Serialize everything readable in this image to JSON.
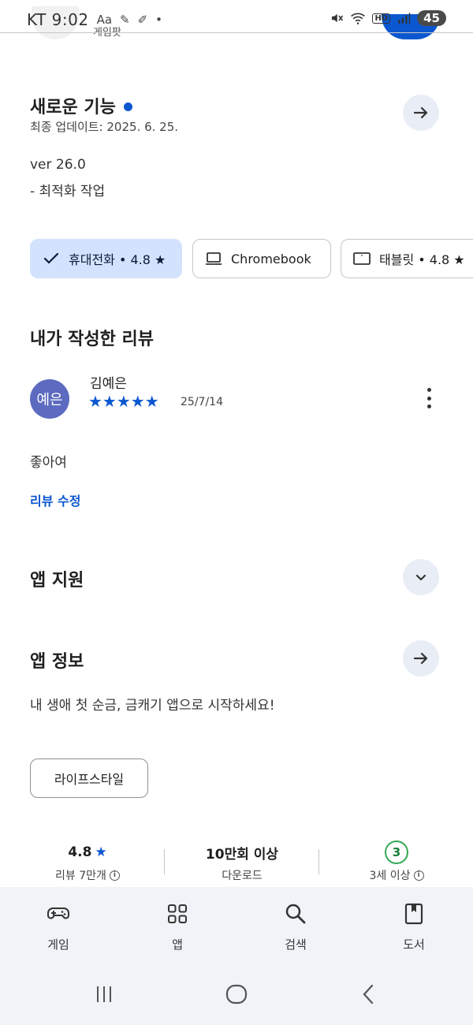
{
  "status_bar": {
    "carrier": "KT",
    "time": "9:02",
    "battery": "45",
    "network_badge": "HD"
  },
  "top_remnant_text": "게임팟",
  "whats_new": {
    "title": "새로운 기능",
    "updated": "최종 업데이트: 2025. 6. 25.",
    "version": "ver 26.0",
    "notes": "- 최적화 작업"
  },
  "device_chips": [
    {
      "label": "휴대전화 • 4.8 ★",
      "icon": "check-icon",
      "selected": true
    },
    {
      "label": "Chromebook",
      "icon": "laptop-icon",
      "selected": false
    },
    {
      "label": "태블릿 • 4.8 ★",
      "icon": "tablet-icon",
      "selected": false
    }
  ],
  "my_review": {
    "title": "내가 작성한 리뷰",
    "avatar_text": "예은",
    "reviewer": "김예은",
    "rating": 5,
    "stars": "★★★★★",
    "date": "25/7/14",
    "text": "좋아여",
    "edit_link": "리뷰 수정"
  },
  "app_support": {
    "title": "앱 지원"
  },
  "app_info": {
    "title": "앱 정보",
    "description": "내 생애 첫 순금, 금캐기 앱으로 시작하세요!",
    "category": "라이프스타일"
  },
  "stats": {
    "rating_value": "4.8",
    "rating_star": "★",
    "rating_label": "리뷰 7만개",
    "downloads_value": "10만회 이상",
    "downloads_label": "다운로드",
    "age_value": "3",
    "age_label": "3세 이상",
    "info_glyph": "i"
  },
  "bottom_nav": {
    "items": [
      {
        "label": "게임",
        "icon": "gamepad-icon"
      },
      {
        "label": "앱",
        "icon": "apps-grid-icon"
      },
      {
        "label": "검색",
        "icon": "search-icon"
      },
      {
        "label": "도서",
        "icon": "book-icon"
      }
    ]
  },
  "colors": {
    "accent": "#0b57d0",
    "chip_selected": "#d3e3fd",
    "round_button": "#e9eef6",
    "nav_background": "#f0f4f9",
    "age_green": "#34a853",
    "avatar": "#5c6bc0"
  }
}
